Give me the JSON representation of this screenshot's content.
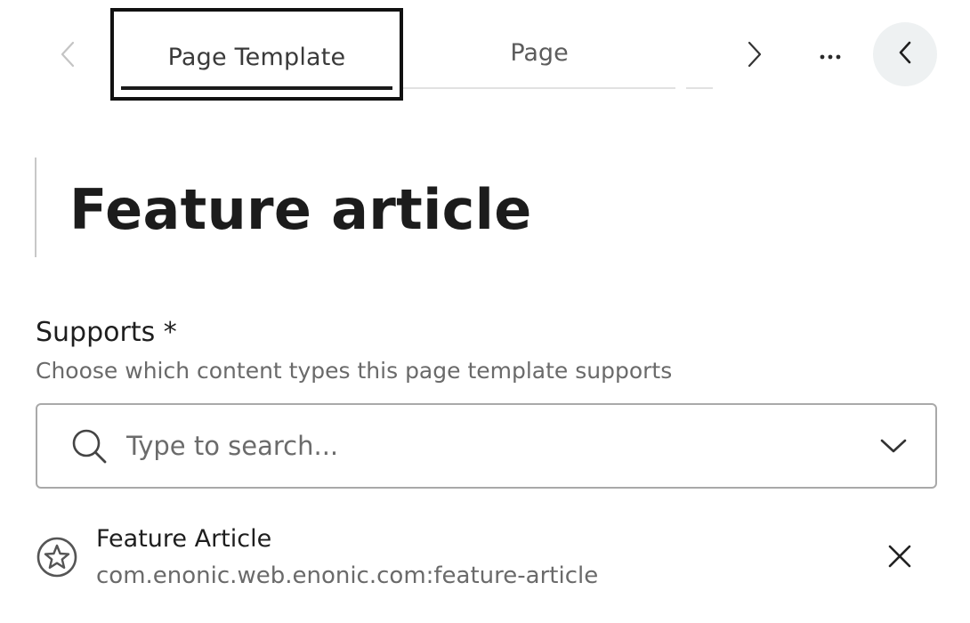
{
  "tabs": {
    "items": [
      {
        "label": "Page Template",
        "active": true
      },
      {
        "label": "Page",
        "active": false
      }
    ],
    "prev_icon": "chevron-left-icon",
    "next_icon": "chevron-right-icon",
    "more_icon": "more-horizontal-icon",
    "collapse_icon": "chevron-left-icon"
  },
  "title": "Feature article",
  "supports": {
    "label": "Supports *",
    "help": "Choose which content types this page template supports",
    "search": {
      "placeholder": "Type to search...",
      "value": "",
      "icon": "search-icon",
      "dropdown_icon": "chevron-down-icon"
    },
    "selected": [
      {
        "title": "Feature Article",
        "subtitle": "com.enonic.web.enonic.com:feature-article",
        "icon": "star-circle-icon",
        "remove_icon": "close-icon"
      }
    ]
  },
  "colors": {
    "text": "#1f1f1f",
    "muted": "#6a6a6a",
    "border": "#a9a9a9",
    "collapse_bg": "#eef1f2",
    "focus_outline": "#111111"
  }
}
